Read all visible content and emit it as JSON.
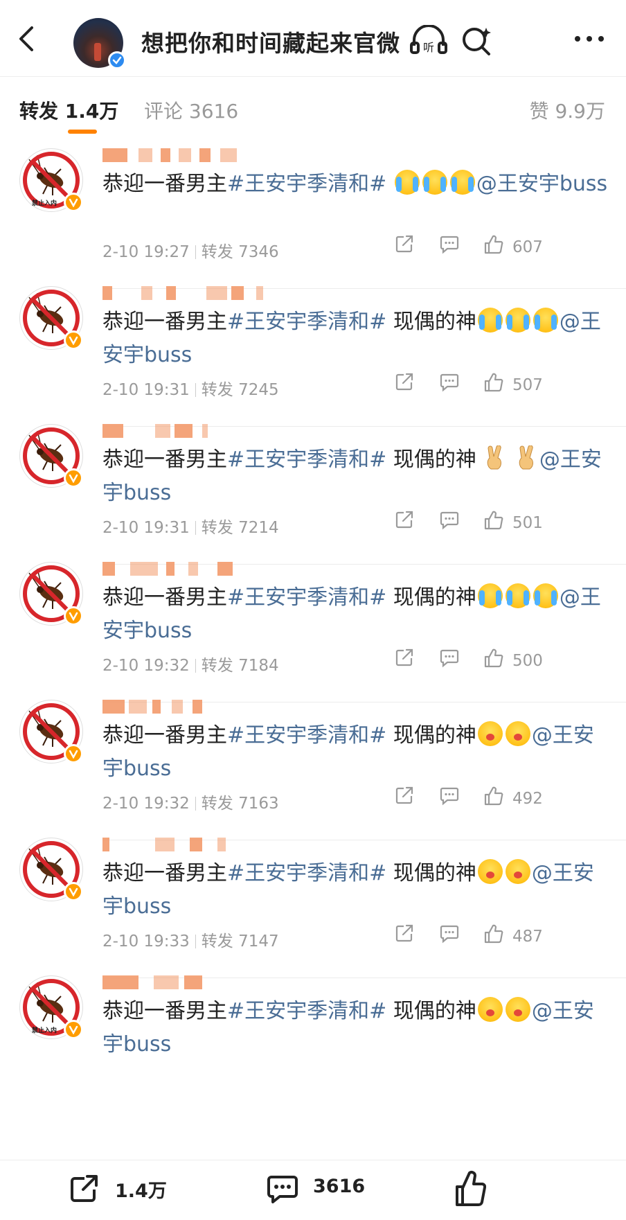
{
  "header": {
    "title": "想把你和时间藏起来官微",
    "listen_label": "听"
  },
  "tabs": {
    "repost": "转发 1.4万",
    "comment": "评论 3616",
    "like": "赞 9.9万"
  },
  "items": [
    {
      "avatar_text": "禁止入内",
      "parts": [
        {
          "t": "恭迎一番男主"
        },
        {
          "t": "#王安宇季清和#",
          "c": "tag"
        },
        {
          "t": " "
        },
        {
          "e": "cry"
        },
        {
          "e": "cry"
        },
        {
          "e": "cry"
        },
        {
          "t": "@王安宇buss",
          "c": "at"
        }
      ],
      "time": "2-10 19:27",
      "repost": "转发 7346",
      "likes": "607"
    },
    {
      "avatar_text": "",
      "parts": [
        {
          "t": "恭迎一番男主"
        },
        {
          "t": "#王安宇季清和#",
          "c": "tag"
        },
        {
          "t": " 现偶的神"
        },
        {
          "e": "cry"
        },
        {
          "e": "cry"
        },
        {
          "e": "cry"
        },
        {
          "t": "@王安宇buss",
          "c": "at"
        }
      ],
      "time": "2-10 19:31",
      "repost": "转发 7245",
      "likes": "507"
    },
    {
      "avatar_text": "",
      "parts": [
        {
          "t": "恭迎一番男主"
        },
        {
          "t": "#王安宇季清和#",
          "c": "tag"
        },
        {
          "t": " 现偶的神 "
        },
        {
          "e": "victory"
        },
        {
          "t": " "
        },
        {
          "e": "victory"
        },
        {
          "t": "@王安宇buss",
          "c": "at"
        }
      ],
      "time": "2-10 19:31",
      "repost": "转发 7214",
      "likes": "501"
    },
    {
      "avatar_text": "",
      "parts": [
        {
          "t": "恭迎一番男主"
        },
        {
          "t": "#王安宇季清和#",
          "c": "tag"
        },
        {
          "t": " 现偶的神"
        },
        {
          "e": "cry"
        },
        {
          "e": "cry"
        },
        {
          "e": "cry"
        },
        {
          "t": "@王安宇buss",
          "c": "at"
        }
      ],
      "time": "2-10 19:32",
      "repost": "转发 7184",
      "likes": "500"
    },
    {
      "avatar_text": "",
      "parts": [
        {
          "t": "恭迎一番男主"
        },
        {
          "t": "#王安宇季清和#",
          "c": "tag"
        },
        {
          "t": " 现偶的神"
        },
        {
          "e": "cute"
        },
        {
          "e": "cute"
        },
        {
          "t": "@王安宇buss",
          "c": "at"
        }
      ],
      "time": "2-10 19:32",
      "repost": "转发 7163",
      "likes": "492"
    },
    {
      "avatar_text": "",
      "parts": [
        {
          "t": "恭迎一番男主"
        },
        {
          "t": "#王安宇季清和#",
          "c": "tag"
        },
        {
          "t": " 现偶的神"
        },
        {
          "e": "cute"
        },
        {
          "e": "cute"
        },
        {
          "t": "@王安宇buss",
          "c": "at"
        }
      ],
      "time": "2-10 19:33",
      "repost": "转发 7147",
      "likes": "487"
    },
    {
      "avatar_text": "禁止入内",
      "parts": [
        {
          "t": "恭迎一番男主"
        },
        {
          "t": "#王安宇季清和#",
          "c": "tag"
        },
        {
          "t": " 现偶的神"
        },
        {
          "e": "cute"
        },
        {
          "e": "cute"
        },
        {
          "t": "@王安宇buss",
          "c": "at"
        }
      ],
      "time": "",
      "repost": "",
      "likes": ""
    }
  ],
  "bottom": {
    "repost_count": "1.4万",
    "comment_count": "3616"
  },
  "colors": {
    "accent": "#ff8200",
    "link": "#4a6d95",
    "verify_blue": "#2d8bf0",
    "badge_orange": "#ff9d00",
    "ban_red": "#d7262b"
  }
}
